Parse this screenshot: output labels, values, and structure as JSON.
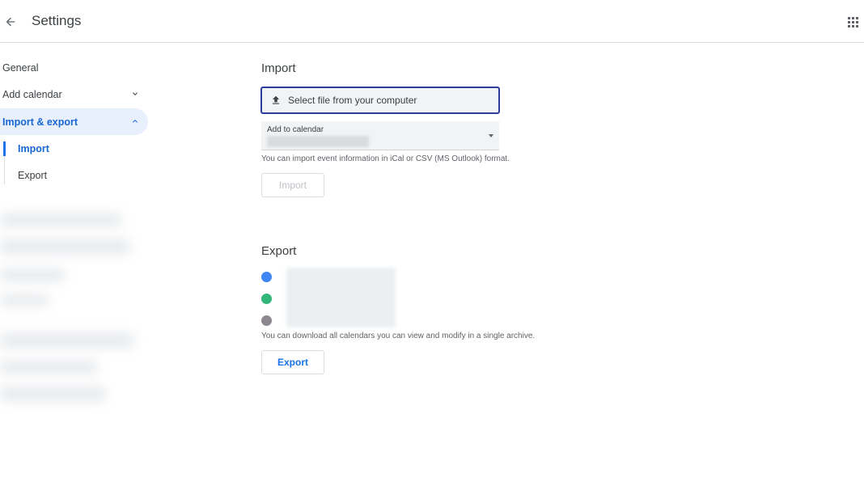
{
  "header": {
    "title": "Settings",
    "back_icon": "arrow-back-icon",
    "apps_icon": "apps-grid-icon"
  },
  "sidebar": {
    "items": [
      {
        "label": "General"
      },
      {
        "label": "Add calendar",
        "icon": "chevron-down-icon"
      },
      {
        "label": "Import & export",
        "icon": "chevron-up-icon",
        "active": true
      }
    ],
    "sub_items": [
      {
        "label": "Import",
        "active": true
      },
      {
        "label": "Export"
      }
    ]
  },
  "import": {
    "title": "Import",
    "select_file_label": "Select file from your computer",
    "select_file_icon": "upload-icon",
    "add_to_calendar_label": "Add to calendar",
    "hint": "You can import event information in iCal or CSV (MS Outlook) format.",
    "import_button": "Import"
  },
  "export": {
    "title": "Export",
    "calendar_dot_colors": [
      "#4285f4",
      "#33b679",
      "#8d8792"
    ],
    "hint": "You can download all calendars you can view and modify in a single archive.",
    "export_button": "Export"
  },
  "colors": {
    "accent": "#1a73e8",
    "active_bg": "#e8f0fe",
    "focus_border": "#2e3e9c"
  }
}
